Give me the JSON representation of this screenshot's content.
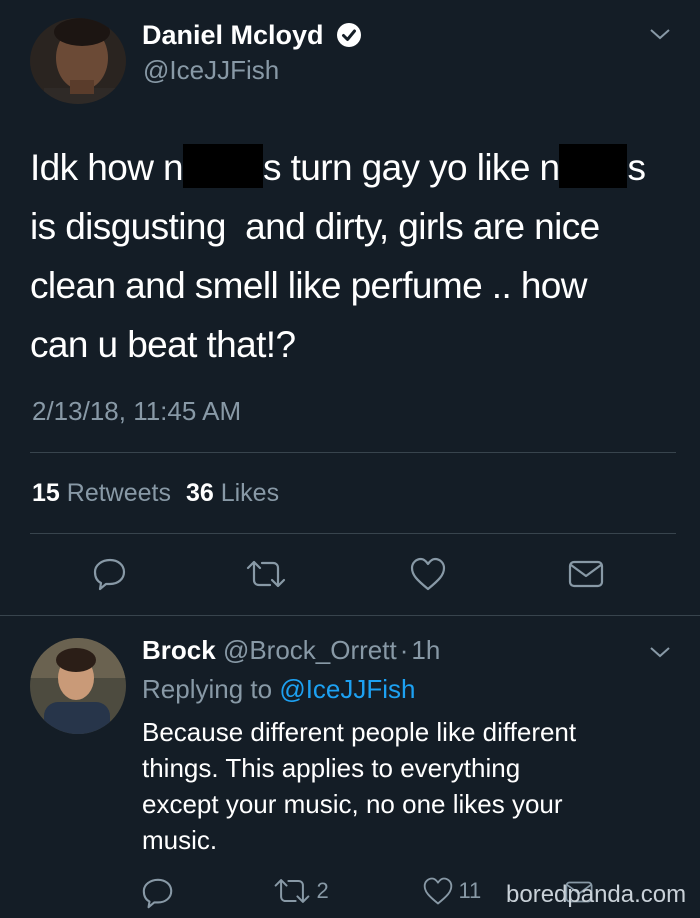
{
  "tweet": {
    "author": {
      "name": "Daniel Mcloyd",
      "handle": "@IceJJFish",
      "verified": true
    },
    "text": {
      "l1_a": "Idk how n",
      "l1_b": "s turn gay yo like n",
      "l1_c": "s",
      "l2": "is disgusting  and dirty, girls are nice",
      "l3": "clean and smell like perfume .. how",
      "l4": "can u beat that!?"
    },
    "timestamp": "2/13/18, 11:45 AM",
    "stats": {
      "retweets_count": "15",
      "retweets_label": "Retweets",
      "likes_count": "36",
      "likes_label": "Likes"
    },
    "actions": {
      "reply": "reply-icon",
      "retweet": "retweet-icon",
      "like": "heart-icon",
      "dm": "envelope-icon"
    }
  },
  "reply": {
    "author": {
      "name": "Brock",
      "handle": "@Brock_Orrett",
      "separator": "·",
      "time": "1h"
    },
    "replying_label": "Replying to",
    "replying_handle": "@IceJJFish",
    "text": {
      "l1": "Because different people like different",
      "l2": "things. This applies to everything",
      "l3": "except your music, no one likes your",
      "l4": "music."
    },
    "retweet_count": "2",
    "like_count": "11"
  },
  "watermark": "boredpanda.com",
  "colors": {
    "background": "#141d26",
    "muted": "#8899a6",
    "link": "#1da1f2",
    "divider": "#38444d"
  }
}
